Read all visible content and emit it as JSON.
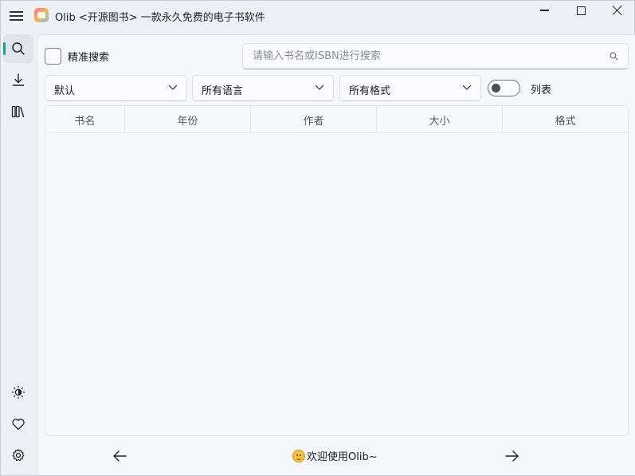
{
  "app": {
    "title": "Olib <开源图书> 一款永久免费的电子书软件",
    "logo_icon": "app-logo-icon"
  },
  "sidebar": {
    "items": [
      {
        "name": "search",
        "icon": "search-icon",
        "active": true
      },
      {
        "name": "download",
        "icon": "download-icon",
        "active": false
      },
      {
        "name": "library",
        "icon": "library-icon",
        "active": false
      }
    ],
    "bottom": [
      {
        "name": "theme",
        "icon": "theme-icon"
      },
      {
        "name": "favorites",
        "icon": "heart-icon"
      },
      {
        "name": "settings",
        "icon": "gear-icon"
      }
    ],
    "accent": "#15a58e"
  },
  "search": {
    "precise_label": "精准搜索",
    "precise_checked": false,
    "placeholder": "请输入书名或ISBN进行搜索",
    "value": ""
  },
  "filters": {
    "sort": "默认",
    "language": "所有语言",
    "format": "所有格式",
    "list_toggle_label": "列表",
    "list_toggle_on": false
  },
  "table": {
    "columns": [
      "书名",
      "年份",
      "作者",
      "大小",
      "格式"
    ],
    "rows": []
  },
  "footer": {
    "welcome": "欢迎使用Olib~"
  }
}
